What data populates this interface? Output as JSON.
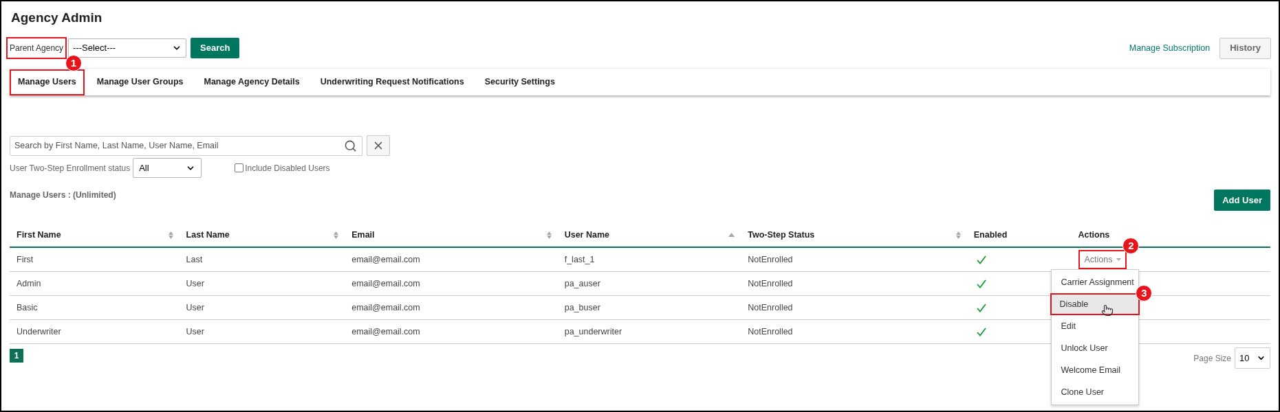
{
  "page": {
    "title": "Agency Admin"
  },
  "parent_agency": {
    "label": "Parent Agency",
    "highlighted": true,
    "annotation": "1",
    "select_value": "---Select---",
    "search_button": "Search"
  },
  "header_links": {
    "manage_subscription": "Manage Subscription",
    "history_button": "History"
  },
  "tabs": [
    {
      "label": "Manage Users",
      "highlighted": true
    },
    {
      "label": "Manage User Groups",
      "highlighted": false
    },
    {
      "label": "Manage Agency Details",
      "highlighted": false
    },
    {
      "label": "Underwriting Request Notifications",
      "highlighted": false
    },
    {
      "label": "Security Settings",
      "highlighted": false
    }
  ],
  "user_search": {
    "placeholder": "Search by First Name, Last Name, User Name, Email"
  },
  "enrollment_filter": {
    "label": "User Two-Step Enrollment status",
    "value": "All"
  },
  "include_disabled": {
    "label": "Include Disabled Users",
    "checked": false
  },
  "section_title": "Manage Users : (Unlimited)",
  "add_user_button": "Add User",
  "table": {
    "columns": [
      {
        "label": "First Name",
        "kind": "sortable"
      },
      {
        "label": "Last Name",
        "kind": "sortable"
      },
      {
        "label": "Email",
        "kind": "sortable"
      },
      {
        "label": "User Name",
        "kind": "sorted"
      },
      {
        "label": "Two-Step Status",
        "kind": "sortable"
      },
      {
        "label": "Enabled",
        "kind": "plain"
      },
      {
        "label": "Actions",
        "kind": "plain"
      }
    ],
    "rows": [
      {
        "first_name": "First",
        "last_name": "Last",
        "email": "email@email.com",
        "user_name": "f_last_1",
        "two_step_status": "NotEnrolled",
        "enabled": true,
        "actions": {
          "label": "Actions",
          "highlighted": true,
          "annotation": "2"
        }
      },
      {
        "first_name": "Admin",
        "last_name": "User",
        "email": "email@email.com",
        "user_name": "pa_auser",
        "two_step_status": "NotEnrolled",
        "enabled": true
      },
      {
        "first_name": "Basic",
        "last_name": "User",
        "email": "email@email.com",
        "user_name": "pa_buser",
        "two_step_status": "NotEnrolled",
        "enabled": true
      },
      {
        "first_name": "Underwriter",
        "last_name": "User",
        "email": "email@email.com",
        "user_name": "pa_underwriter",
        "two_step_status": "NotEnrolled",
        "enabled": true
      }
    ]
  },
  "actions_menu": {
    "items": [
      {
        "label": "Carrier Assignment",
        "hovered": false,
        "highlighted": false
      },
      {
        "label": "Disable",
        "hovered": true,
        "highlighted": true,
        "annotation": "3"
      },
      {
        "label": "Edit",
        "hovered": false,
        "highlighted": false
      },
      {
        "label": "Unlock User",
        "hovered": false,
        "highlighted": false
      },
      {
        "label": "Welcome Email",
        "hovered": false,
        "highlighted": false
      },
      {
        "label": "Clone User",
        "hovered": false,
        "highlighted": false
      }
    ]
  },
  "pagination": {
    "pages": [
      {
        "label": "1",
        "selected": true
      }
    ],
    "page_size_label": "Page Size",
    "page_size": "10"
  }
}
